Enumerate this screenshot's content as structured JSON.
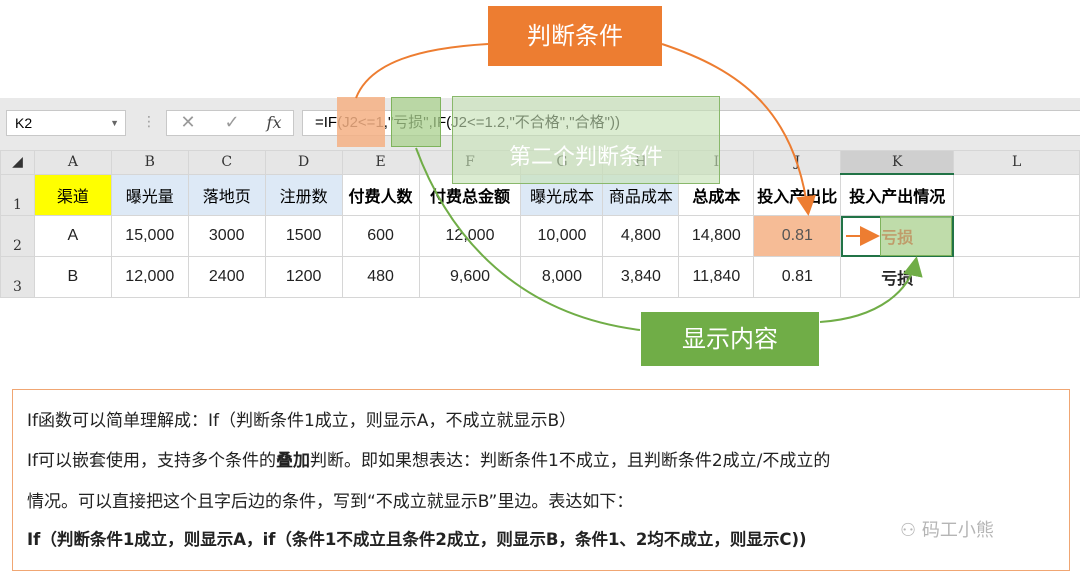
{
  "formula_bar": {
    "name_box": "K2",
    "cancel_icon": "✕",
    "confirm_icon": "✓",
    "fx_label": "fx",
    "formula": "=IF(J2<=1,\"亏损\",IF(J2<=1.2,\"不合格\",\"合格\"))"
  },
  "columns": [
    "A",
    "B",
    "C",
    "D",
    "E",
    "F",
    "G",
    "H",
    "I",
    "J",
    "K",
    "L"
  ],
  "rows": [
    "1",
    "2",
    "3"
  ],
  "headers": [
    "渠道",
    "曝光量",
    "落地页",
    "注册数",
    "付费人数",
    "付费总金额",
    "曝光成本",
    "商品成本",
    "总成本",
    "投入产出比",
    "投入产出情况"
  ],
  "data_rows": [
    [
      "A",
      "15,000",
      "3000",
      "1500",
      "600",
      "12,000",
      "10,000",
      "4,800",
      "14,800",
      "0.81",
      "亏损"
    ],
    [
      "B",
      "12,000",
      "2400",
      "1200",
      "480",
      "9,600",
      "8,000",
      "3,840",
      "11,840",
      "0.81",
      "亏损"
    ]
  ],
  "callouts": {
    "condition": "判断条件",
    "second_condition": "第二个判断条件",
    "display": "显示内容"
  },
  "colors": {
    "orange": "#ed7d31",
    "green": "#70ad47",
    "excel_green": "#217346",
    "header_yellow": "#ffff00",
    "header_blue": "#dde9f6",
    "loss_red": "#ff0000"
  },
  "description": {
    "line1": "If函数可以简单理解成：If（判断条件1成立，则显示A，不成立就显示B）",
    "line2_a": "If可以嵌套使用，支持多个条件的",
    "line2_bold": "叠加",
    "line2_b": "判断。即如果想表达：判断条件1不成立，且判断条件2成立/不成立的",
    "line3": "情况。可以直接把这个且字后边的条件，写到“不成立就显示B”里边。表达如下：",
    "line4": "If（判断条件1成立，则显示A，if（条件1不成立且条件2成立，则显示B，条件1、2均不成立，则显示C))"
  },
  "watermark": "码工小熊"
}
